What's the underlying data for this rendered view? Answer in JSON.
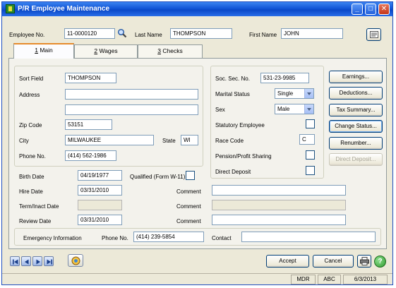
{
  "window": {
    "title": "P/R Employee Maintenance"
  },
  "header": {
    "employee_no_label": "Employee No.",
    "employee_no": "11-0000120",
    "last_name_label": "Last Name",
    "last_name": "THOMPSON",
    "first_name_label": "First Name",
    "first_name": "JOHN"
  },
  "tabs": [
    {
      "number": "1",
      "label": "Main"
    },
    {
      "number": "2",
      "label": "Wages"
    },
    {
      "number": "3",
      "label": "Checks"
    }
  ],
  "main": {
    "sort_field_label": "Sort Field",
    "sort_field": "THOMPSON",
    "address_label": "Address",
    "address1": "",
    "address2": "",
    "zip_label": "Zip Code",
    "zip": "53151",
    "city_label": "City",
    "city": "MILWAUKEE",
    "state_label": "State",
    "state": "WI",
    "phone_label": "Phone No.",
    "phone": "(414) 562-1986",
    "ssn_label": "Soc. Sec. No.",
    "ssn": "531-23-9985",
    "marital_label": "Marital Status",
    "marital": "Single",
    "sex_label": "Sex",
    "sex": "Male",
    "statutory_label": "Statutory Employee",
    "race_label": "Race Code",
    "race": "C",
    "pension_label": "Pension/Profit Sharing",
    "direct_deposit_label": "Direct Deposit",
    "birth_label": "Birth Date",
    "birth": "04/19/1977",
    "qualified_label": "Qualified (Form W-11)",
    "hire_label": "Hire Date",
    "hire": "03/31/2010",
    "term_label": "Term/Inact Date",
    "term": "",
    "review_label": "Review Date",
    "review": "03/31/2010",
    "comment_label": "Comment",
    "hire_comment": "",
    "term_comment": "",
    "review_comment": "",
    "emergency_label": "Emergency Information",
    "emergency_phone_label": "Phone No.",
    "emergency_phone": "(414) 239-5854",
    "contact_label": "Contact",
    "contact": ""
  },
  "side_buttons": {
    "earnings": "Earnings...",
    "deductions": "Deductions...",
    "tax_summary": "Tax Summary...",
    "change_status": "Change Status...",
    "renumber": "Renumber...",
    "direct_deposit": "Direct Deposit..."
  },
  "footer": {
    "accept": "Accept",
    "cancel": "Cancel"
  },
  "status": {
    "user": "MDR",
    "company": "ABC",
    "date": "6/3/2013"
  },
  "colors": {
    "titlebar": "#0a48c8",
    "tab_highlight": "#e68b2c",
    "background": "#ece9d8"
  },
  "icons": [
    "app-icon",
    "lookup-icon",
    "notes-icon",
    "first-record-icon",
    "previous-record-icon",
    "next-record-icon",
    "last-record-icon",
    "memo-icon",
    "print-icon",
    "help-icon",
    "minimize-icon",
    "maximize-icon",
    "close-icon"
  ]
}
